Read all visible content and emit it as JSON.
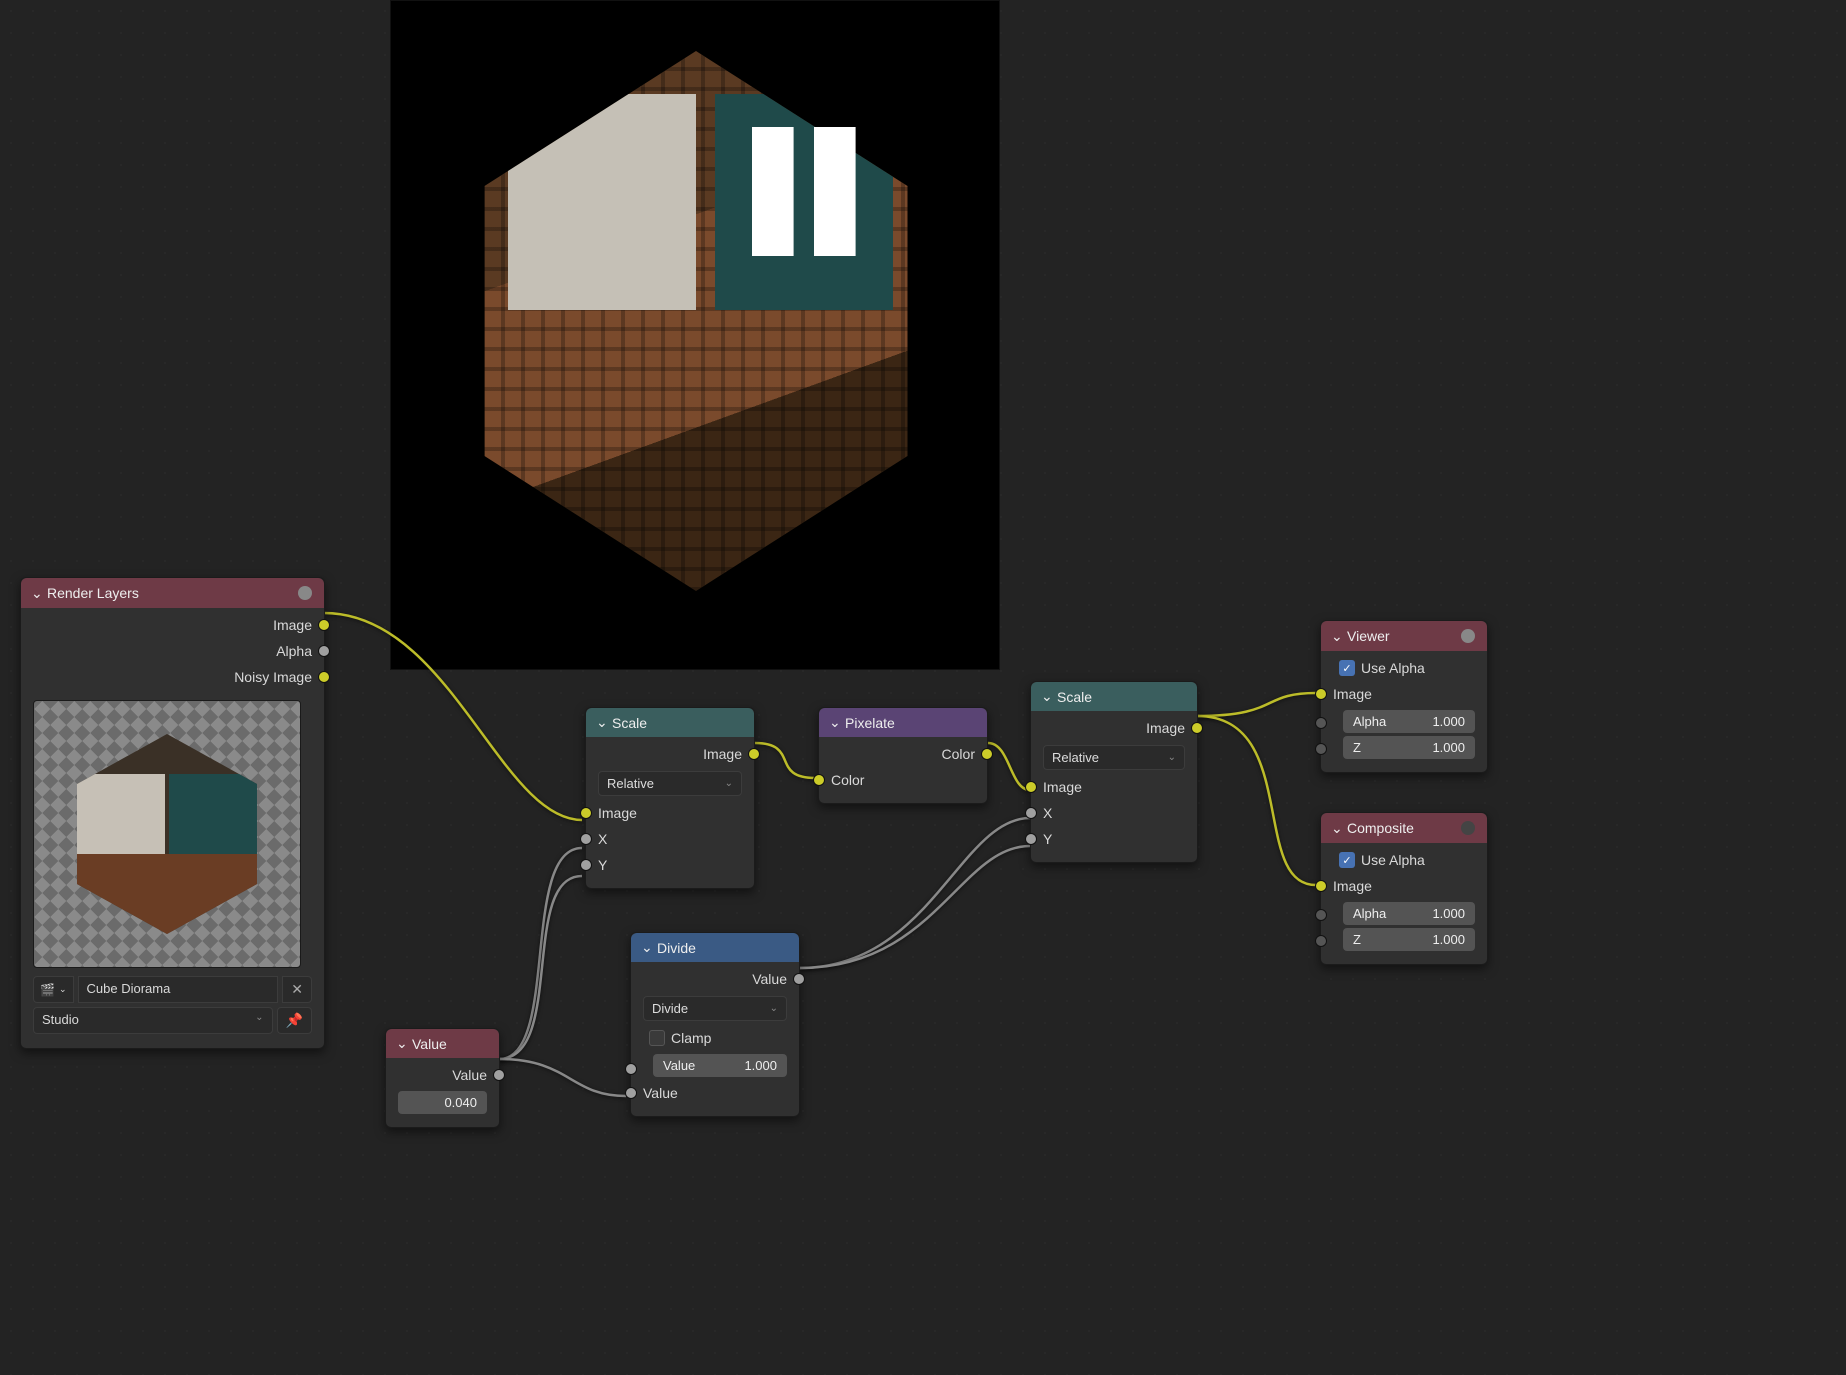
{
  "render_layers": {
    "title": "Render Layers",
    "outputs": {
      "image": "Image",
      "alpha": "Alpha",
      "noisy": "Noisy Image"
    },
    "scene_icon": "scene-icon",
    "scene_name": "Cube Diorama",
    "layer_name": "Studio"
  },
  "value_node": {
    "title": "Value",
    "output_label": "Value",
    "value": "0.040"
  },
  "scale1": {
    "title": "Scale",
    "out_image": "Image",
    "method": "Relative",
    "in_image": "Image",
    "in_x": "X",
    "in_y": "Y"
  },
  "divide": {
    "title": "Divide",
    "out_value": "Value",
    "operation": "Divide",
    "clamp": "Clamp",
    "in_value_label": "Value",
    "in_value_num": "1.000",
    "in_value2": "Value"
  },
  "pixelate": {
    "title": "Pixelate",
    "out_color": "Color",
    "in_color": "Color"
  },
  "scale2": {
    "title": "Scale",
    "out_image": "Image",
    "method": "Relative",
    "in_image": "Image",
    "in_x": "X",
    "in_y": "Y"
  },
  "viewer": {
    "title": "Viewer",
    "use_alpha": "Use Alpha",
    "in_image": "Image",
    "alpha_label": "Alpha",
    "alpha_value": "1.000",
    "z_label": "Z",
    "z_value": "1.000"
  },
  "composite": {
    "title": "Composite",
    "use_alpha": "Use Alpha",
    "in_image": "Image",
    "alpha_label": "Alpha",
    "alpha_value": "1.000",
    "z_label": "Z",
    "z_value": "1.000"
  }
}
